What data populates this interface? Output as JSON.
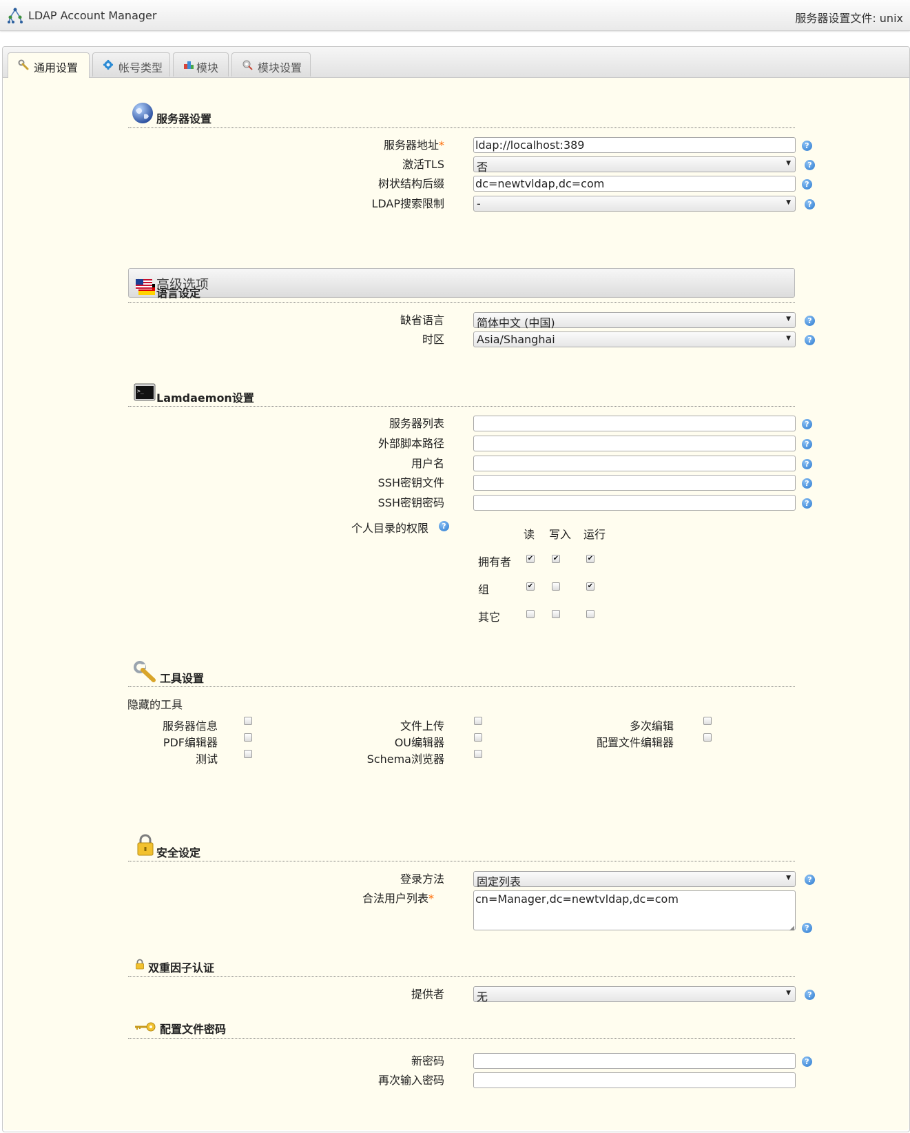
{
  "header": {
    "app_title": "LDAP Account Manager",
    "server_profile": "服务器设置文件: unix"
  },
  "tabs": [
    {
      "label": "通用设置",
      "icon": "wrench-icon",
      "active": true
    },
    {
      "label": "帐号类型",
      "icon": "gear-icon",
      "active": false
    },
    {
      "label": "模块",
      "icon": "modules-icon",
      "active": false
    },
    {
      "label": "模块设置",
      "icon": "module-settings-icon",
      "active": false
    }
  ],
  "server_settings": {
    "title": "服务器设置",
    "address_label": "服务器地址",
    "address_value": "ldap://localhost:389",
    "tls_label": "激活TLS",
    "tls_value": "否",
    "suffix_label": "树状结构后缀",
    "suffix_value": "dc=newtvldap,dc=com",
    "search_limit_label": "LDAP搜索限制",
    "search_limit_value": "-",
    "advanced_label": "高级选项"
  },
  "language_settings": {
    "title": "语言设定",
    "language_label": "缺省语言",
    "language_value": "简体中文 (中国)",
    "timezone_label": "时区",
    "timezone_value": "Asia/Shanghai"
  },
  "lamdaemon": {
    "title": "Lamdaemon设置",
    "server_list_label": "服务器列表",
    "script_path_label": "外部脚本路径",
    "user_label": "用户名",
    "ssh_key_label": "SSH密钥文件",
    "ssh_key_password_label": "SSH密钥密码",
    "permissions_label": "个人目录的权限",
    "permissions": {
      "columns": [
        "读",
        "写入",
        "运行"
      ],
      "rows": [
        {
          "label": "拥有者",
          "values": [
            true,
            true,
            true
          ]
        },
        {
          "label": "组",
          "values": [
            true,
            false,
            true
          ]
        },
        {
          "label": "其它",
          "values": [
            false,
            false,
            false
          ]
        }
      ]
    }
  },
  "tools": {
    "title": "工具设置",
    "hidden_tools_label": "隐藏的工具",
    "items": [
      {
        "label": "服务器信息",
        "checked": false
      },
      {
        "label": "文件上传",
        "checked": false
      },
      {
        "label": "多次编辑",
        "checked": false
      },
      {
        "label": "PDF编辑器",
        "checked": false
      },
      {
        "label": "OU编辑器",
        "checked": false
      },
      {
        "label": "配置文件编辑器",
        "checked": false
      },
      {
        "label": "测试",
        "checked": false
      },
      {
        "label": "Schema浏览器",
        "checked": false
      }
    ]
  },
  "security": {
    "title": "安全设定",
    "login_method_label": "登录方法",
    "login_method_value": "固定列表",
    "valid_users_label": "合法用户列表",
    "valid_users_value": "cn=Manager,dc=newtvldap,dc=com"
  },
  "two_factor": {
    "title": "双重因子认证",
    "provider_label": "提供者",
    "provider_value": "无"
  },
  "profile_password": {
    "title": "配置文件密码",
    "new_password_label": "新密码",
    "repeat_password_label": "再次输入密码"
  },
  "colors": {
    "content_bg": "#fffdef",
    "help_blue": "#2a79cf",
    "required_orange": "#ff6a00"
  }
}
